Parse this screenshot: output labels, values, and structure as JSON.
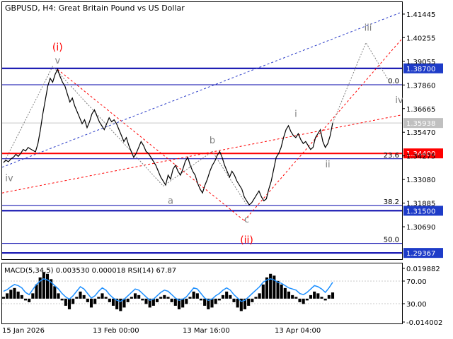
{
  "header": {
    "symbol": "GBPUSD",
    "timeframe": "H4",
    "description": "Great Britain Pound vs US Dollar"
  },
  "colors": {
    "axis": "#000000",
    "grid": "#c8c8c8",
    "price_line": "#000000",
    "level_red": "#ff0000",
    "level_blue": "#0000aa",
    "label_blue_bg": "#1e3cc8",
    "wave_red": "#ff0000",
    "wave_grey": "#7f7f7f",
    "trend_blue": "#2a3cc8",
    "macd_hist": "#000000",
    "rsi_line": "#1e90ff"
  },
  "chart_data": [
    {
      "type": "line",
      "title": "GBPUSD, H4:  Great Britain Pound vs US Dollar",
      "y_ticks": [
        "1.41445",
        "1.40255",
        "1.39055",
        "1.37860",
        "1.36665",
        "1.35470",
        "1.34275",
        "1.33080",
        "1.31885",
        "1.30690"
      ],
      "y_range": [
        1.2905,
        1.4205
      ],
      "x_ticks": [
        "15 Jan 2026",
        "13 Feb 00:00",
        "13 Mar 16:00",
        "13 Apr 04:00"
      ],
      "current_price": "1.35938",
      "levels": [
        {
          "value": 1.387,
          "label": "1.38700",
          "color": "#0000aa"
        },
        {
          "value": 1.344,
          "label": "1.34400",
          "color": "#ff0000"
        },
        {
          "value": 1.315,
          "label": "1.31500",
          "color": "#0000aa"
        },
        {
          "value": 1.29367,
          "label": "1.29367",
          "color": "#0000aa"
        }
      ],
      "fibonacci": [
        {
          "label": "0.0",
          "value": 1.3787
        },
        {
          "label": "23.6",
          "value": 1.3413
        },
        {
          "label": "38.2",
          "value": 1.3177
        },
        {
          "label": "50.0",
          "value": 1.2985
        }
      ],
      "wave_labels": [
        {
          "text": "(i)",
          "color": "#ff0000"
        },
        {
          "text": "v",
          "color": "#7f7f7f"
        },
        {
          "text": "iv",
          "color": "#7f7f7f"
        },
        {
          "text": "a",
          "color": "#7f7f7f"
        },
        {
          "text": "b",
          "color": "#7f7f7f"
        },
        {
          "text": "c",
          "color": "#7f7f7f"
        },
        {
          "text": "(ii)",
          "color": "#ff0000"
        },
        {
          "text": "i",
          "color": "#7f7f7f"
        },
        {
          "text": "ii",
          "color": "#7f7f7f"
        },
        {
          "text": "iii",
          "color": "#7f7f7f"
        },
        {
          "text": "iv",
          "color": "#7f7f7f"
        }
      ],
      "price_series": [
        1.3395,
        1.3405,
        1.3398,
        1.3412,
        1.342,
        1.3435,
        1.3425,
        1.344,
        1.346,
        1.3452,
        1.347,
        1.3462,
        1.3455,
        1.3448,
        1.349,
        1.356,
        1.364,
        1.371,
        1.378,
        1.382,
        1.38,
        1.384,
        1.3865,
        1.383,
        1.38,
        1.378,
        1.374,
        1.37,
        1.372,
        1.368,
        1.365,
        1.362,
        1.359,
        1.361,
        1.357,
        1.36,
        1.364,
        1.366,
        1.363,
        1.36,
        1.358,
        1.356,
        1.359,
        1.362,
        1.36,
        1.361,
        1.359,
        1.356,
        1.353,
        1.35,
        1.352,
        1.348,
        1.345,
        1.342,
        1.344,
        1.347,
        1.35,
        1.348,
        1.345,
        1.344,
        1.342,
        1.34,
        1.338,
        1.335,
        1.332,
        1.33,
        1.328,
        1.333,
        1.331,
        1.336,
        1.338,
        1.335,
        1.333,
        1.336,
        1.34,
        1.342,
        1.338,
        1.335,
        1.333,
        1.329,
        1.326,
        1.324,
        1.328,
        1.331,
        1.335,
        1.338,
        1.34,
        1.343,
        1.345,
        1.342,
        1.338,
        1.335,
        1.332,
        1.335,
        1.333,
        1.33,
        1.328,
        1.326,
        1.322,
        1.32,
        1.318,
        1.319,
        1.321,
        1.323,
        1.325,
        1.322,
        1.32,
        1.321,
        1.326,
        1.33,
        1.336,
        1.342,
        1.344,
        1.347,
        1.352,
        1.356,
        1.358,
        1.355,
        1.353,
        1.352,
        1.354,
        1.351,
        1.349,
        1.35,
        1.348,
        1.346,
        1.347,
        1.352,
        1.354,
        1.356,
        1.35,
        1.347,
        1.349,
        1.353,
        1.3594
      ]
    },
    {
      "type": "line",
      "title": "MACD(5,34,5) 0.003530 0.000018 RSI(14) 67.87",
      "y_ticks": [
        "0.019882",
        "70.00",
        "30.00",
        "-0.014002"
      ],
      "macd_hist": [
        0.001,
        0.003,
        0.005,
        0.006,
        0.004,
        0.002,
        -0.001,
        -0.002,
        0.003,
        0.008,
        0.012,
        0.015,
        0.014,
        0.011,
        0.007,
        0.003,
        -0.001,
        -0.004,
        -0.006,
        -0.003,
        0.001,
        0.004,
        0.002,
        -0.002,
        -0.005,
        -0.003,
        0.001,
        0.003,
        0.001,
        -0.002,
        -0.004,
        -0.006,
        -0.007,
        -0.005,
        -0.002,
        0.001,
        0.003,
        0.002,
        -0.001,
        -0.003,
        -0.005,
        -0.004,
        -0.002,
        0.001,
        0.002,
        0.001,
        -0.002,
        -0.004,
        -0.006,
        -0.005,
        -0.003,
        0.001,
        0.004,
        0.003,
        -0.001,
        -0.004,
        -0.006,
        -0.005,
        -0.003,
        -0.001,
        0.002,
        0.004,
        0.002,
        -0.002,
        -0.005,
        -0.007,
        -0.006,
        -0.004,
        -0.002,
        0.001,
        0.003,
        0.008,
        0.012,
        0.014,
        0.013,
        0.01,
        0.008,
        0.006,
        0.004,
        0.002,
        0.001,
        -0.002,
        -0.003,
        -0.001,
        0.002,
        0.004,
        0.003,
        0.001,
        -0.001,
        0.002,
        0.0035
      ],
      "rsi": [
        52,
        55,
        60,
        64,
        62,
        58,
        50,
        46,
        55,
        64,
        70,
        74,
        72,
        68,
        62,
        56,
        48,
        42,
        38,
        44,
        52,
        60,
        56,
        48,
        40,
        44,
        52,
        58,
        54,
        46,
        40,
        36,
        34,
        38,
        44,
        50,
        56,
        54,
        48,
        42,
        36,
        38,
        44,
        50,
        54,
        52,
        46,
        40,
        36,
        38,
        42,
        50,
        58,
        56,
        48,
        40,
        36,
        38,
        44,
        48,
        54,
        58,
        54,
        46,
        40,
        34,
        36,
        42,
        48,
        54,
        60,
        68,
        72,
        74,
        72,
        68,
        66,
        62,
        58,
        56,
        54,
        48,
        46,
        50,
        56,
        62,
        60,
        56,
        50,
        58,
        67.87
      ]
    }
  ]
}
